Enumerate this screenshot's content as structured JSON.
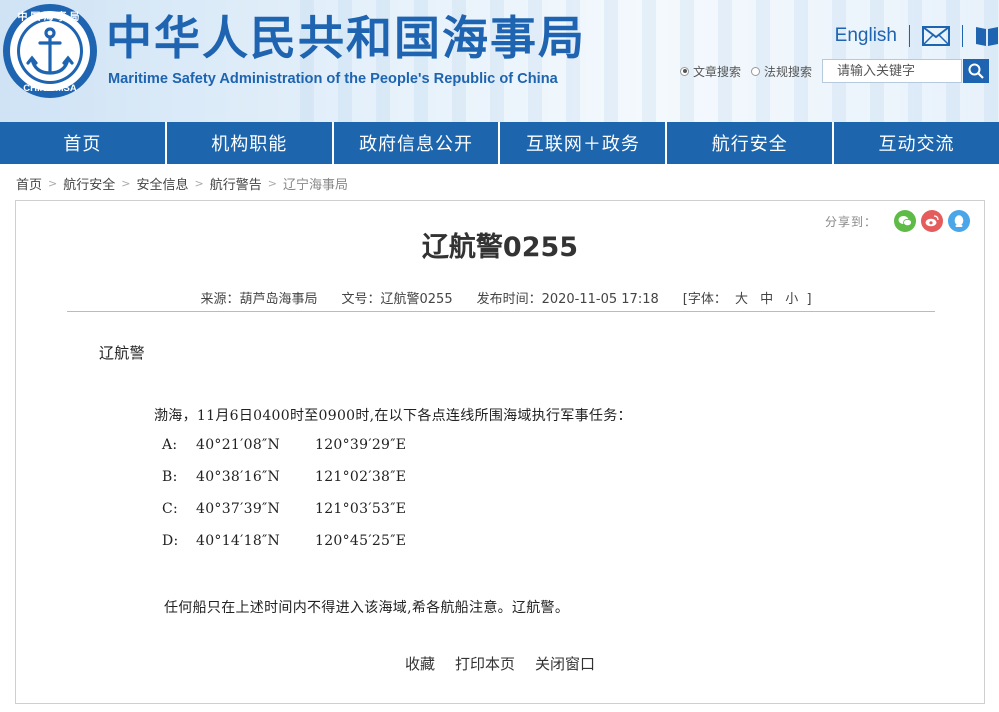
{
  "colors": {
    "brand_blue": "#1e64b0",
    "nav_bg": "#1d66ae",
    "wechat_green": "#5dbb46",
    "weibo_red": "#e45c5c",
    "qq_blue": "#4aa6e8"
  },
  "header": {
    "logo_top_text": "中国海事局",
    "logo_bottom_text": "CHINA MSA",
    "title_cn": "中华人民共和国海事局",
    "title_en": "Maritime Safety Administration of the People's Republic of China",
    "language_link": "English",
    "mail_icon": "envelope-icon",
    "book_icon": "book-icon",
    "search": {
      "options": [
        {
          "label": "文章搜索",
          "selected": true
        },
        {
          "label": "法规搜索",
          "selected": false
        }
      ],
      "placeholder": "请输入关键字",
      "button_icon": "search-icon"
    }
  },
  "nav": {
    "items": [
      {
        "label": "首页"
      },
      {
        "label": "机构职能"
      },
      {
        "label": "政府信息公开"
      },
      {
        "label": "互联网＋政务"
      },
      {
        "label": "航行安全"
      },
      {
        "label": "互动交流"
      }
    ]
  },
  "breadcrumb": {
    "separator": ">",
    "items": [
      {
        "label": "首页"
      },
      {
        "label": "航行安全"
      },
      {
        "label": "安全信息"
      },
      {
        "label": "航行警告"
      },
      {
        "label": "辽宁海事局"
      }
    ]
  },
  "article": {
    "share_label": "分享到：",
    "share_icons": [
      "wechat-icon",
      "weibo-icon",
      "qq-icon"
    ],
    "title": "辽航警0255",
    "meta": {
      "source": "来源：葫芦岛海事局",
      "doc_no": "文号：辽航警0255",
      "published": "发布时间：2020-11-05 17:18",
      "font_label": "[字体：",
      "font_sizes": [
        "大",
        "中",
        "小"
      ],
      "font_close": "]"
    },
    "heading": "辽航警",
    "intro": "渤海，11月6日0400时至0900时,在以下各点连线所围海域执行军事任务：",
    "points": [
      {
        "key": "A:",
        "lat": "40°21′08″N",
        "lon": "120°39′29″E"
      },
      {
        "key": "B:",
        "lat": "40°38′16″N",
        "lon": "121°02′38″E"
      },
      {
        "key": "C:",
        "lat": "40°37′39″N",
        "lon": "121°03′53″E"
      },
      {
        "key": "D:",
        "lat": "40°14′18″N",
        "lon": "120°45′25″E"
      }
    ],
    "notice": "任何船只在上述时间内不得进入该海域,希各航船注意。辽航警。",
    "actions": [
      "收藏",
      "打印本页",
      "关闭窗口"
    ]
  }
}
